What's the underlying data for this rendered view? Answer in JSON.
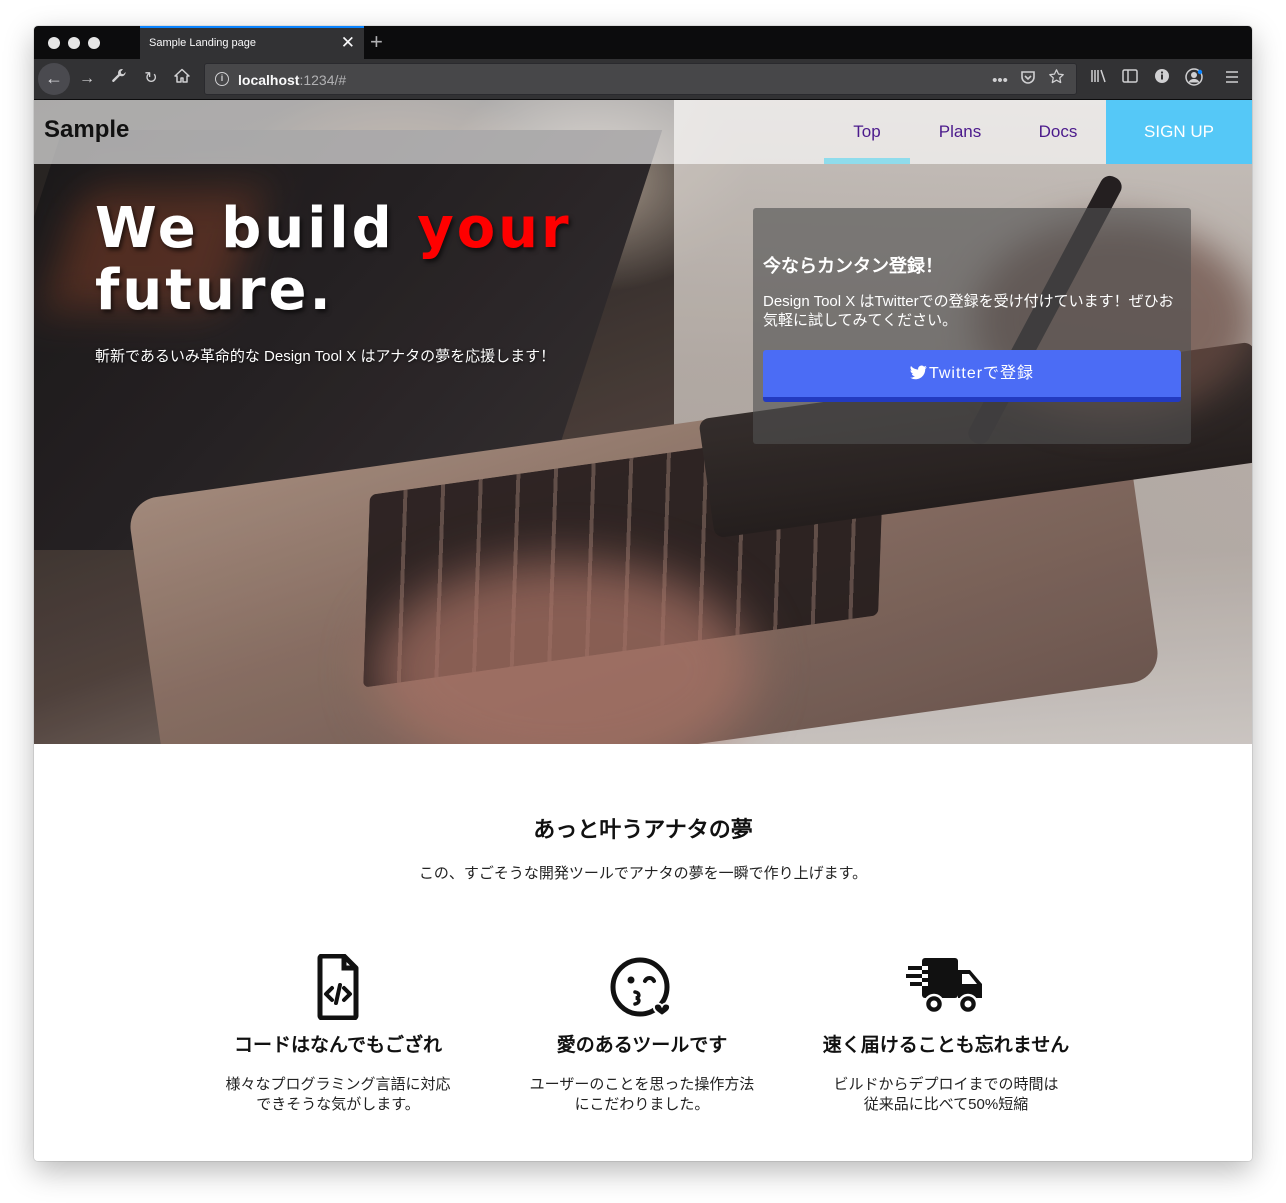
{
  "browser": {
    "tab_title": "Sample Landing page",
    "tab_close": "✕",
    "new_tab": "+",
    "url_host": "localhost",
    "url_path": ":1234/#",
    "url_actions": [
      "•••",
      "☐",
      "☆"
    ],
    "toolbar_icons": [
      "library-icon",
      "sidebar-icon",
      "info-icon",
      "profile-icon",
      "menu-icon"
    ]
  },
  "header": {
    "brand": "Sample",
    "nav": [
      {
        "label": "Top",
        "active": true
      },
      {
        "label": "Plans",
        "active": false
      },
      {
        "label": "Docs",
        "active": false
      }
    ],
    "signup": "SIGN UP"
  },
  "hero": {
    "headline_part1": "We build ",
    "headline_accent": "your",
    "headline_part2": "future.",
    "subtitle": "斬新であるいみ革命的な Design Tool X はアナタの夢を応援します！",
    "panel_title": "今ならカンタン登録！",
    "panel_text": "Design Tool X はTwitterでの登録を受け付けています！ぜひお気軽に試してみてください。",
    "panel_button": "Twitterで登録"
  },
  "features": {
    "title": "あっと叶うアナタの夢",
    "subtitle": "この、すごそうな開発ツールでアナタの夢を一瞬で作り上げます。",
    "items": [
      {
        "icon": "file-code-icon",
        "title": "コードはなんでもござれ",
        "desc_line1": "様々なプログラミング言語に対応",
        "desc_line2": "できそうな気がします。"
      },
      {
        "icon": "kiss-heart-icon",
        "title": "愛のあるツールです",
        "desc_line1": "ユーザーのことを思った操作方法",
        "desc_line2": "にこだわりました。"
      },
      {
        "icon": "shipping-fast-icon",
        "title": "速く届けることも忘れません",
        "desc_line1": "ビルドからデプロイまでの時間は",
        "desc_line2": "従来品に比べて50%短縮"
      }
    ]
  },
  "colors": {
    "accent_red": "#ff0000",
    "nav_text": "#4b1a8c",
    "signup_bg": "#55c8f7",
    "active_bar": "#8fdcec",
    "twitter_btn": "#4b6cf5"
  }
}
